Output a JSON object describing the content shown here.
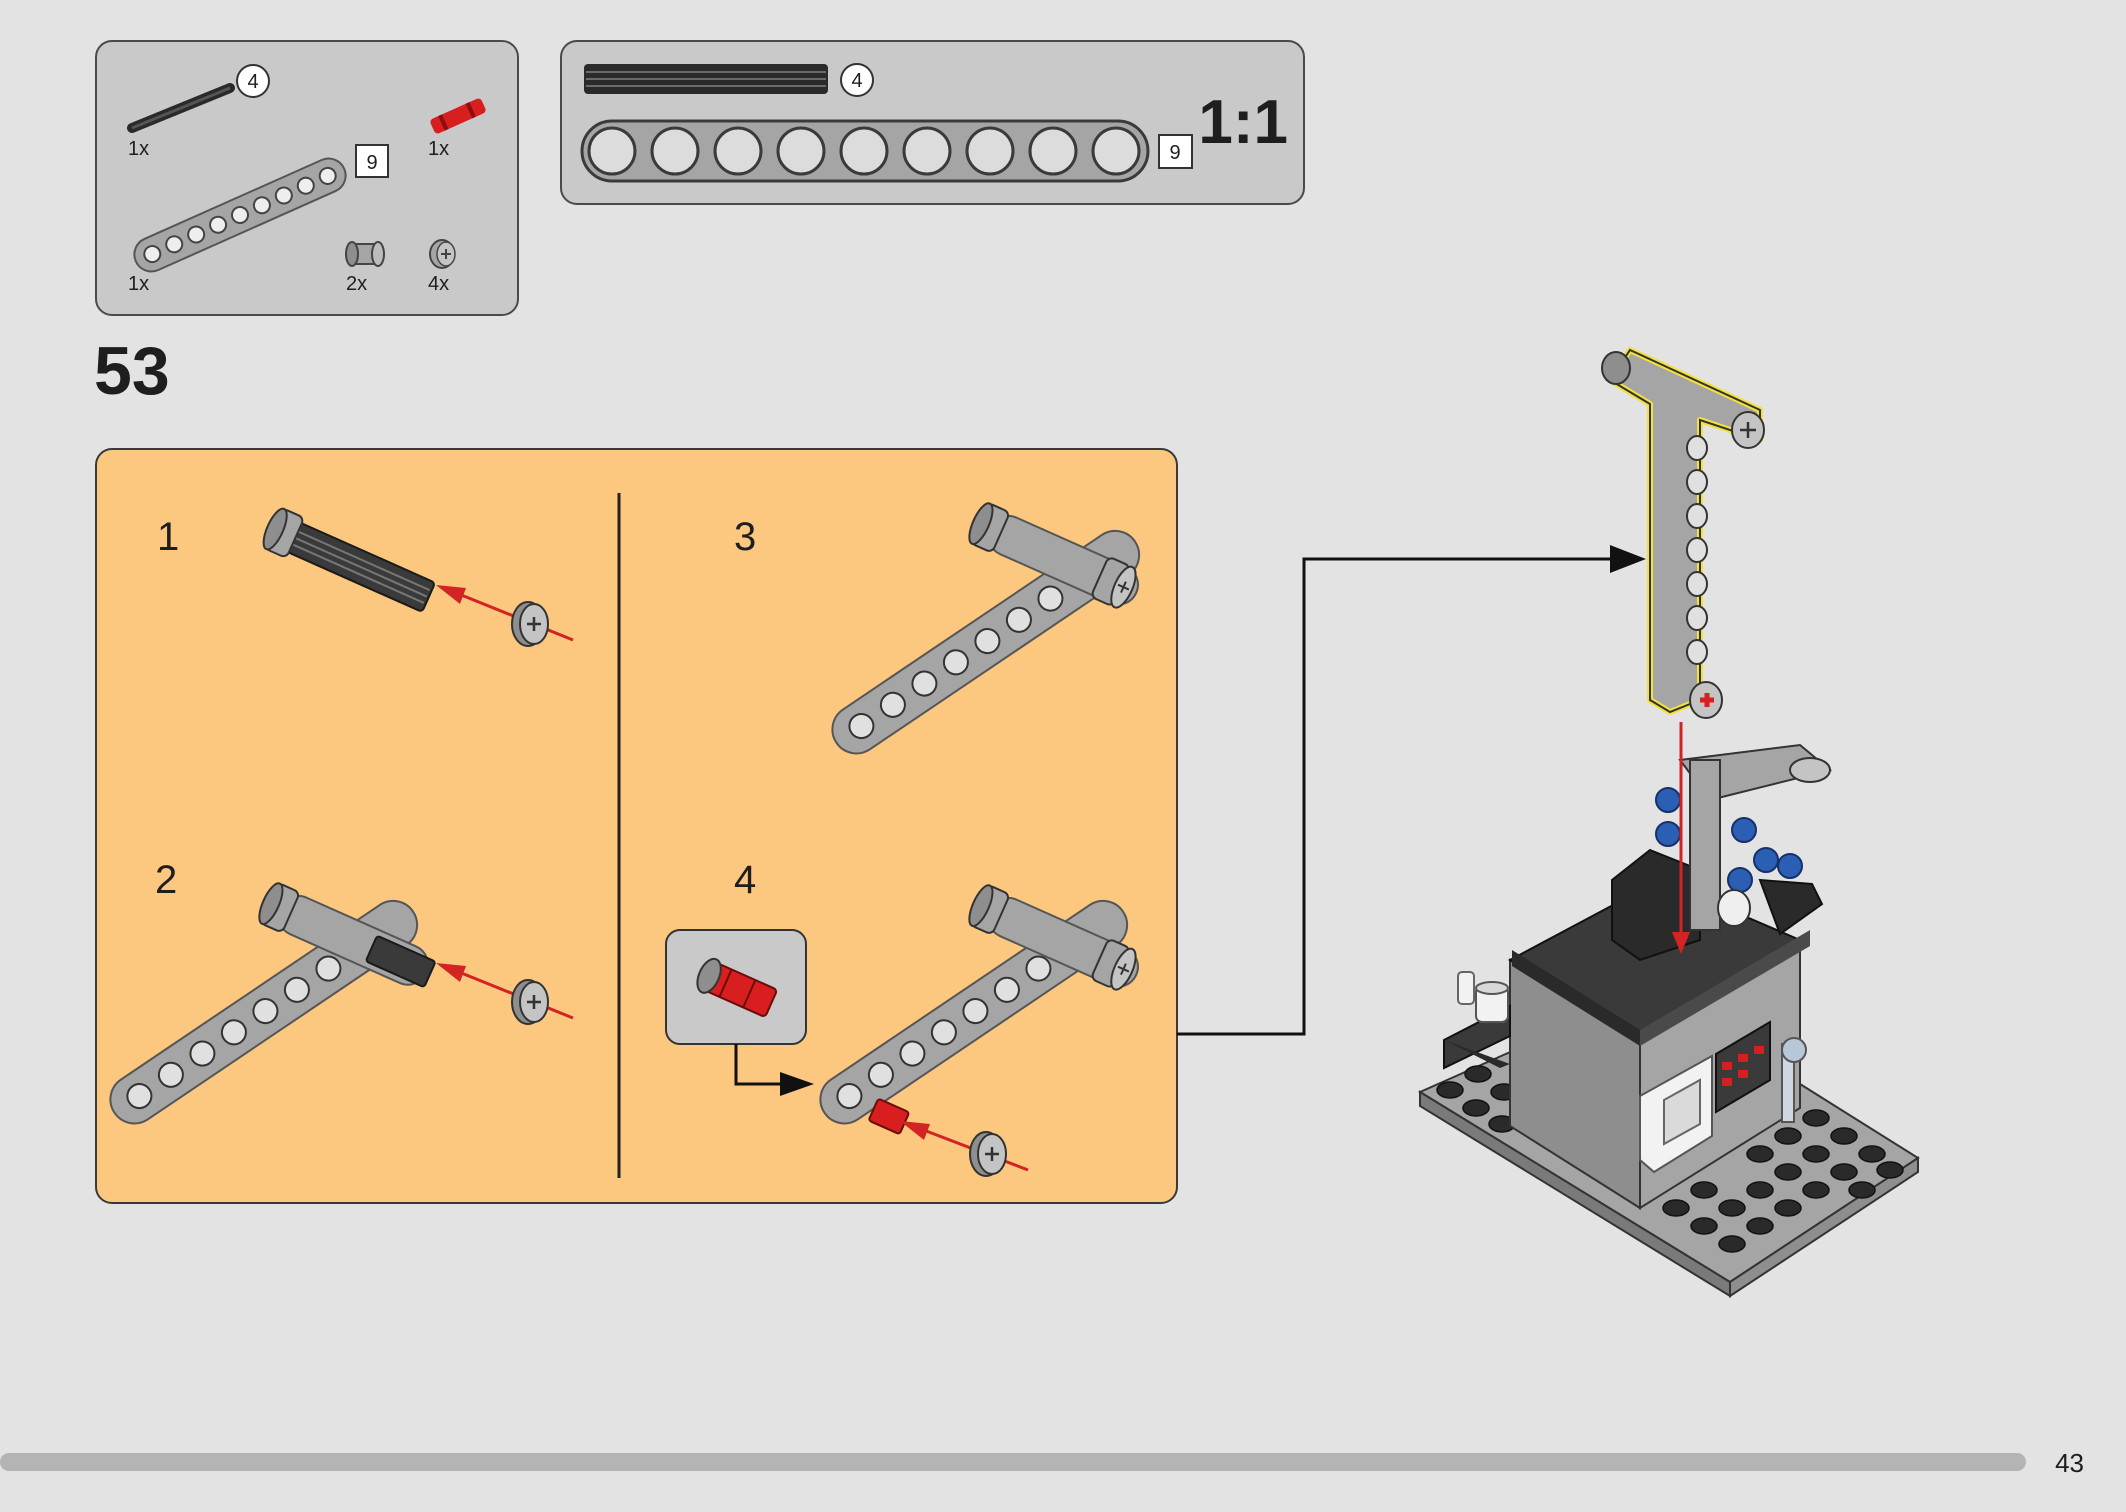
{
  "step": {
    "number": "53"
  },
  "parts_list": {
    "items": [
      {
        "name": "axle-4",
        "size_label": "4",
        "quantity": "1x"
      },
      {
        "name": "axle-connector-red",
        "quantity": "1x"
      },
      {
        "name": "beam-9",
        "size_label": "9",
        "quantity": "1x"
      },
      {
        "name": "bush",
        "quantity": "2x"
      },
      {
        "name": "half-bush",
        "quantity": "4x"
      }
    ]
  },
  "scale_box": {
    "axle_length_label": "4",
    "beam_length_label": "9",
    "scale_label": "1:1"
  },
  "substeps": [
    {
      "label": "1"
    },
    {
      "label": "2"
    },
    {
      "label": "3"
    },
    {
      "label": "4"
    }
  ],
  "page_number": "43",
  "colors": {
    "background": "#e3e3e3",
    "parts_panel": "#c9c9c9",
    "substep_panel": "#fcc77f",
    "lego_gray": "#a5a5a5",
    "lego_dark": "#2a2a2a",
    "lego_red": "#d81e1e",
    "lego_blue": "#2b5fb4",
    "arrow_red": "#d32424",
    "highlight_yellow": "#f2e23a",
    "progress_bar": "#b4b4b4"
  }
}
